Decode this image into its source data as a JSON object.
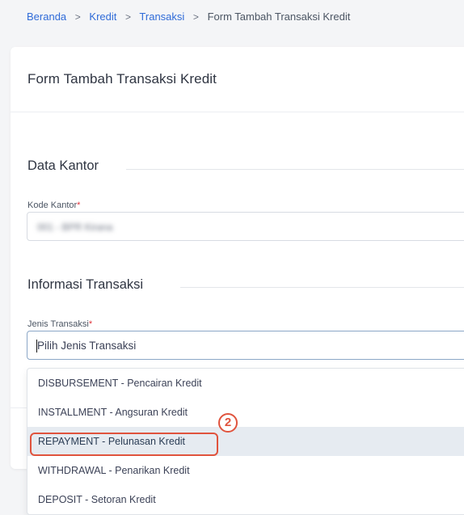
{
  "breadcrumb": {
    "items": [
      {
        "label": "Beranda"
      },
      {
        "label": "Kredit"
      },
      {
        "label": "Transaksi"
      }
    ],
    "separator": ">",
    "current": "Form Tambah Transaksi Kredit"
  },
  "card": {
    "title": "Form Tambah Transaksi Kredit"
  },
  "sections": {
    "office": {
      "title": "Data Kantor",
      "field_label": "Kode Kantor",
      "required_mark": "*",
      "value": "001 - BPR Kirana"
    },
    "transaction": {
      "title": "Informasi Transaksi",
      "field_label": "Jenis Transaksi",
      "required_mark": "*",
      "placeholder": "Pilih Jenis Transaksi"
    }
  },
  "dropdown": {
    "options": [
      "DISBURSEMENT - Pencairan Kredit",
      "INSTALLMENT - Angsuran Kredit",
      "REPAYMENT - Pelunasan Kredit",
      "WITHDRAWAL - Penarikan Kredit",
      "DEPOSIT - Setoran Kredit"
    ],
    "highlighted_index": 2
  },
  "annotation": {
    "step_number": "2",
    "color": "#e0533d"
  },
  "colors": {
    "link": "#2f6bd8",
    "required": "#e0343b",
    "highlight_bg": "#e6ebf1"
  }
}
